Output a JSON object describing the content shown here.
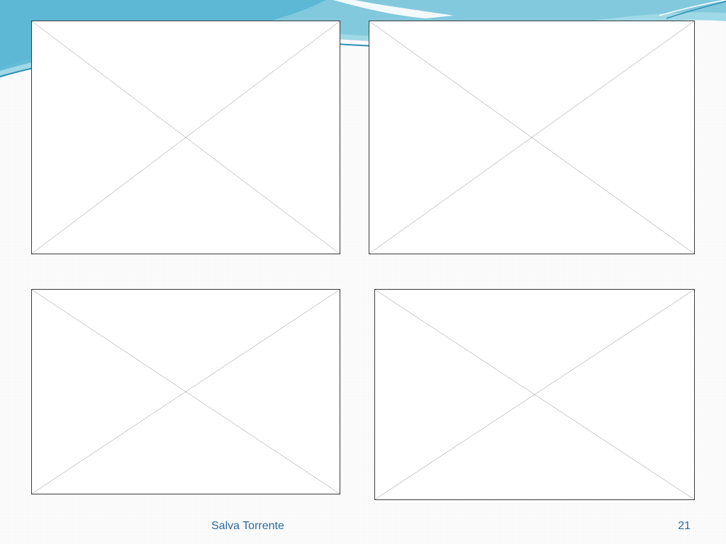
{
  "footer": {
    "author": "Salva Torrente",
    "page_number": "21"
  },
  "theme": {
    "wave_light": "#a9dde8",
    "wave_mid": "#7cc7dc",
    "wave_dark": "#3a9fc0",
    "footer_text": "#2a6aa0"
  },
  "placeholders": [
    {
      "type": "empty-image-placeholder"
    },
    {
      "type": "empty-image-placeholder"
    },
    {
      "type": "empty-image-placeholder"
    },
    {
      "type": "empty-image-placeholder"
    }
  ]
}
